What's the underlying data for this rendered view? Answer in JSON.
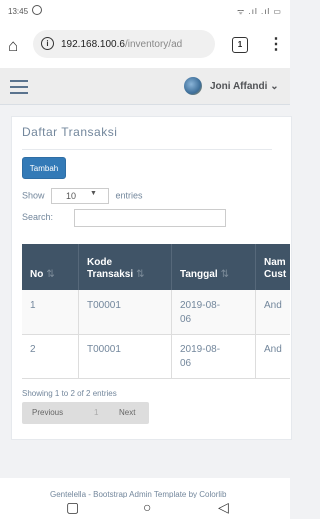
{
  "statusbar": {
    "time": "13:45",
    "signal": "ᯤ .ıl .ıl ▭"
  },
  "browser": {
    "url_host": "192.168.100.6",
    "url_path": "/inventory/ad",
    "tab_count": "1"
  },
  "navbar": {
    "username": "Joni Affandi",
    "caret": "⌄"
  },
  "panel": {
    "title": "Daftar Transaksi"
  },
  "toolbar": {
    "tambah_label": "Tambah"
  },
  "length": {
    "show_label": "Show",
    "value": "10",
    "entries_label": "entries"
  },
  "search": {
    "label": "Search:"
  },
  "table": {
    "headers": [
      "No",
      "Kode\nTransaksi",
      "Tanggal",
      "Nam\nCust"
    ],
    "rows": [
      [
        "1",
        "T00001",
        "2019-08-\n06",
        "And"
      ],
      [
        "2",
        "T00001",
        "2019-08-\n06",
        "And"
      ]
    ]
  },
  "info": {
    "text": "Showing 1 to 2 of 2 entries"
  },
  "pager": {
    "previous": "Previous",
    "current": "1",
    "next": "Next"
  },
  "footer": {
    "text": "Gentelella - Bootstrap Admin Template by Colorlib"
  }
}
